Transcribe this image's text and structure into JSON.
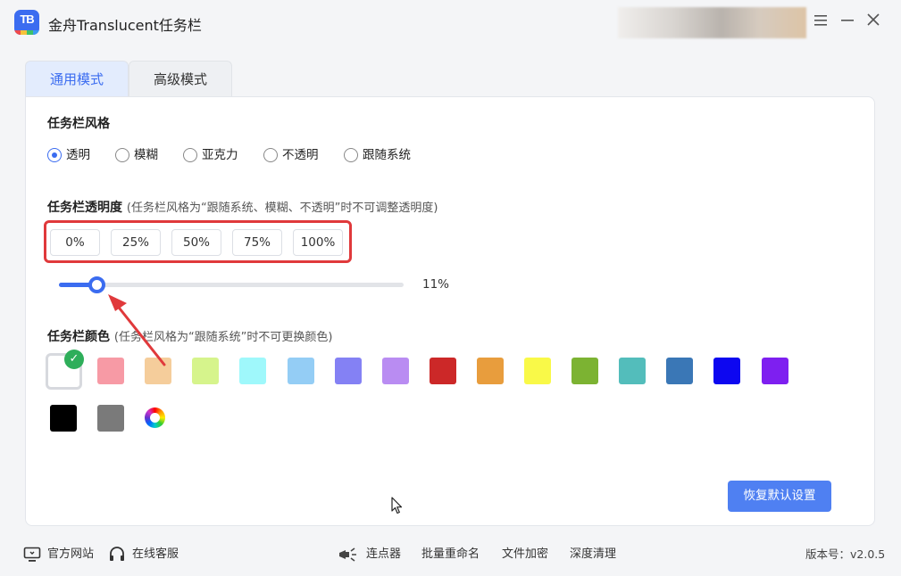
{
  "app": {
    "title": "金舟Translucent任务栏",
    "logo_text": "TB",
    "accent": "#3b6cf0"
  },
  "window_controls": {
    "menu_icon": "menu-icon",
    "minimize_icon": "minimize-icon",
    "close_icon": "close-icon"
  },
  "tabs": [
    {
      "label": "通用模式",
      "active": true
    },
    {
      "label": "高级模式",
      "active": false
    }
  ],
  "style_section": {
    "title": "任务栏风格",
    "options": [
      {
        "label": "透明",
        "checked": true
      },
      {
        "label": "模糊",
        "checked": false
      },
      {
        "label": "亚克力",
        "checked": false
      },
      {
        "label": "不透明",
        "checked": false
      },
      {
        "label": "跟随系统",
        "checked": false
      }
    ]
  },
  "opacity_section": {
    "title": "任务栏透明度",
    "note": "(任务栏风格为“跟随系统、模糊、不透明”时不可调整透明度)",
    "presets": [
      "0%",
      "25%",
      "50%",
      "75%",
      "100%"
    ],
    "slider_value": 11,
    "slider_label": "11%"
  },
  "color_section": {
    "title": "任务栏颜色",
    "note": "(任务栏风格为“跟随系统”时不可更换颜色)",
    "colors": [
      "#ffffff",
      "#f79aa5",
      "#f5cd9b",
      "#d6f48c",
      "#9ff8fb",
      "#94cdf5",
      "#8481f4",
      "#b98cf2",
      "#cc2828",
      "#e89d3d",
      "#f9f948",
      "#7cb332",
      "#53bdbb",
      "#3a77b6",
      "#0d07f0",
      "#7e1ff0",
      "#000000",
      "#7a7a7a"
    ],
    "selected_index": 0,
    "custom_icon": "color-wheel-icon"
  },
  "reset_button": "恢复默认设置",
  "footer": {
    "website": "官方网站",
    "support": "在线客服",
    "clicker": "连点器",
    "rename": "批量重命名",
    "encrypt": "文件加密",
    "clean": "深度清理",
    "version": "版本号：v2.0.5"
  }
}
